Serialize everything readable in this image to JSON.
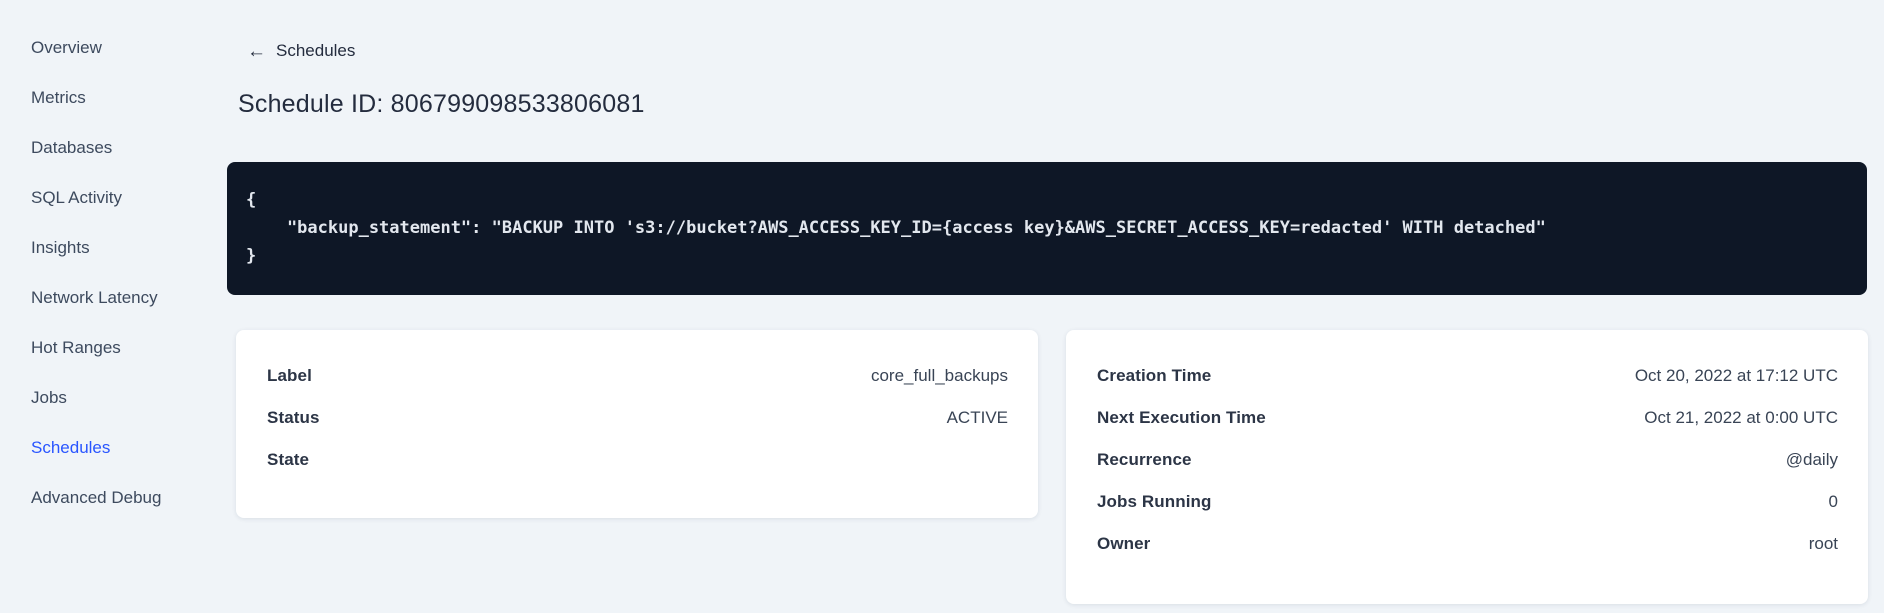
{
  "colors": {
    "accent": "#2955ff",
    "page_bg": "#f0f4f8",
    "code_bg": "#0e1726",
    "card_bg": "#ffffff"
  },
  "sidebar": {
    "items": [
      {
        "label": "Overview",
        "active": false
      },
      {
        "label": "Metrics",
        "active": false
      },
      {
        "label": "Databases",
        "active": false
      },
      {
        "label": "SQL Activity",
        "active": false
      },
      {
        "label": "Insights",
        "active": false
      },
      {
        "label": "Network Latency",
        "active": false
      },
      {
        "label": "Hot Ranges",
        "active": false
      },
      {
        "label": "Jobs",
        "active": false
      },
      {
        "label": "Schedules",
        "active": true
      },
      {
        "label": "Advanced Debug",
        "active": false
      }
    ]
  },
  "header": {
    "back_icon": "arrow-left-icon",
    "back_arrow_glyph": "←",
    "back_label": "Schedules",
    "title": "Schedule ID: 806799098533806081"
  },
  "code_block": {
    "text": "{\n    \"backup_statement\": \"BACKUP INTO 's3://bucket?AWS_ACCESS_KEY_ID={access key}&AWS_SECRET_ACCESS_KEY=redacted' WITH detached\"\n}"
  },
  "details_card": {
    "rows": [
      {
        "label": "Label",
        "value": "core_full_backups"
      },
      {
        "label": "Status",
        "value": "ACTIVE"
      },
      {
        "label": "State",
        "value": ""
      }
    ]
  },
  "schedule_card": {
    "rows": [
      {
        "label": "Creation Time",
        "value": "Oct 20, 2022 at 17:12 UTC"
      },
      {
        "label": "Next Execution Time",
        "value": "Oct 21, 2022 at 0:00 UTC"
      },
      {
        "label": "Recurrence",
        "value": "@daily"
      },
      {
        "label": "Jobs Running",
        "value": "0"
      },
      {
        "label": "Owner",
        "value": "root"
      }
    ]
  }
}
